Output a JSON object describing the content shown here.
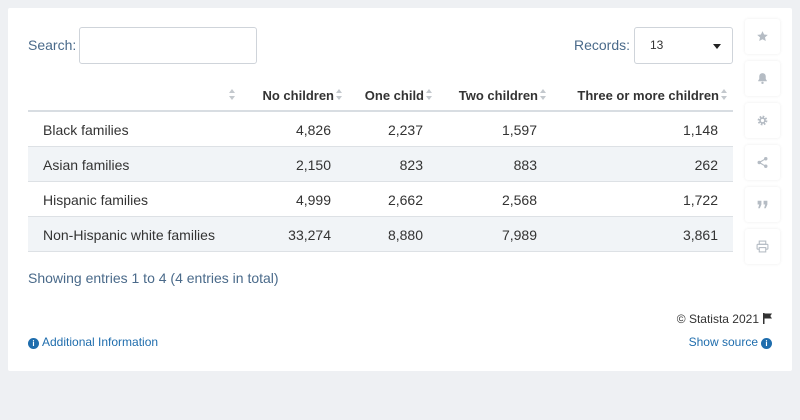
{
  "search": {
    "label": "Search:",
    "value": ""
  },
  "records": {
    "label": "Records:",
    "value": "13"
  },
  "table": {
    "columns": [
      "",
      "No children",
      "One child",
      "Two children",
      "Three or more children"
    ],
    "rows": [
      [
        "Black families",
        "4,826",
        "2,237",
        "1,597",
        "1,148"
      ],
      [
        "Asian families",
        "2,150",
        "823",
        "883",
        "262"
      ],
      [
        "Hispanic families",
        "4,999",
        "2,662",
        "2,568",
        "1,722"
      ],
      [
        "Non-Hispanic white families",
        "33,274",
        "8,880",
        "7,989",
        "3,861"
      ]
    ]
  },
  "footer": {
    "showing": "Showing entries 1 to 4 (4 entries in total)",
    "copyright": "© Statista 2021",
    "additional_info": "Additional Information",
    "show_source": "Show source"
  },
  "sidebar_icons": [
    "star-icon",
    "bell-icon",
    "gear-icon",
    "share-icon",
    "quote-icon",
    "print-icon"
  ],
  "colors": {
    "link": "#1f6dad",
    "muted_text": "#4a6a8a",
    "row_alt": "#f1f4f7",
    "page_bg": "#eef0f3"
  }
}
